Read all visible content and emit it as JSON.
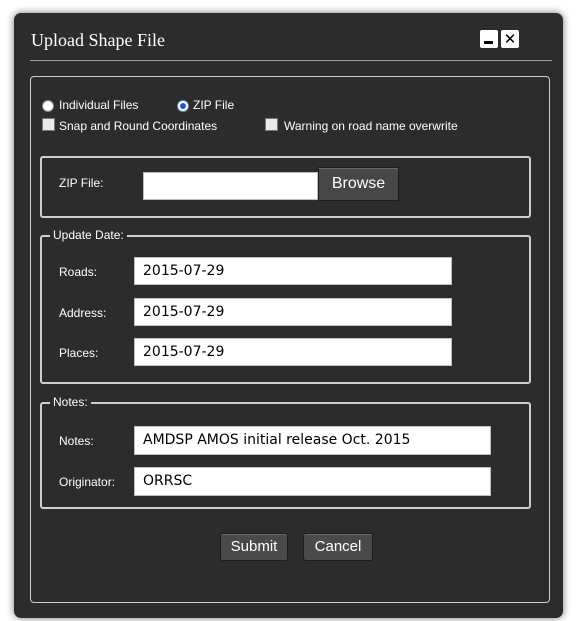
{
  "dialog": {
    "title": "Upload Shape File",
    "minimize_icon": "minimize-icon",
    "close_icon": "close-icon",
    "close_glyph": "✕"
  },
  "upload_mode": {
    "options": [
      {
        "label": "Individual Files",
        "selected": false
      },
      {
        "label": "ZIP File",
        "selected": true
      }
    ]
  },
  "checkboxes": {
    "snap_label": "Snap and Round Coordinates",
    "snap_checked": false,
    "warning_label": "Warning on road name overwrite",
    "warning_checked": false
  },
  "zip_section": {
    "label": "ZIP File:",
    "value": "",
    "browse_label": "Browse"
  },
  "update_date": {
    "legend": "Update Date:",
    "roads_label": "Roads:",
    "roads_value": "2015-07-29",
    "address_label": "Address:",
    "address_value": "2015-07-29",
    "places_label": "Places:",
    "places_value": "2015-07-29"
  },
  "notes": {
    "legend": "Notes:",
    "notes_label": "Notes:",
    "notes_value": "AMDSP AMOS initial release Oct. 2015",
    "originator_label": "Originator:",
    "originator_value": "ORRSC"
  },
  "actions": {
    "submit_label": "Submit",
    "cancel_label": "Cancel"
  },
  "colors": {
    "dialog_bg": "#2c2c2c",
    "text": "#ffffff",
    "button_bg": "#4a4a4a",
    "radio_selected": "#2456b8"
  }
}
